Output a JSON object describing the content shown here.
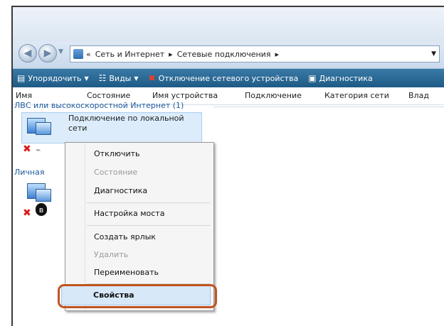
{
  "address": {
    "prefix": "«",
    "crumb1": "Сеть и Интернет",
    "sep": "▸",
    "crumb2": "Сетевые подключения",
    "sep2": "▸"
  },
  "toolbar": {
    "organize": "Упорядочить",
    "views": "Виды",
    "disable": "Отключение сетевого устройства",
    "diagnostics": "Диагностика"
  },
  "columns": [
    "Имя",
    "Состояние",
    "Имя устройства",
    "Подключение",
    "Категория сети",
    "Влад"
  ],
  "groups": {
    "lan": "ЛВС или высокоскоростной Интернет (1)",
    "personal": "Личная"
  },
  "item": {
    "label": "Подключение по локальной сети"
  },
  "menu": {
    "items": [
      {
        "label": "Отключить",
        "disabled": false
      },
      {
        "label": "Состояние",
        "disabled": true
      },
      {
        "label": "Диагностика",
        "disabled": false
      },
      {
        "label": "Настройка моста",
        "disabled": false
      },
      {
        "label": "Создать ярлык",
        "disabled": false
      },
      {
        "label": "Удалить",
        "disabled": true
      },
      {
        "label": "Переименовать",
        "disabled": false
      },
      {
        "label": "Свойства",
        "disabled": false
      }
    ]
  },
  "colors": {
    "toolbar": "#1e5a86",
    "ring": "#c0551f",
    "selection": "#dcecfb"
  }
}
